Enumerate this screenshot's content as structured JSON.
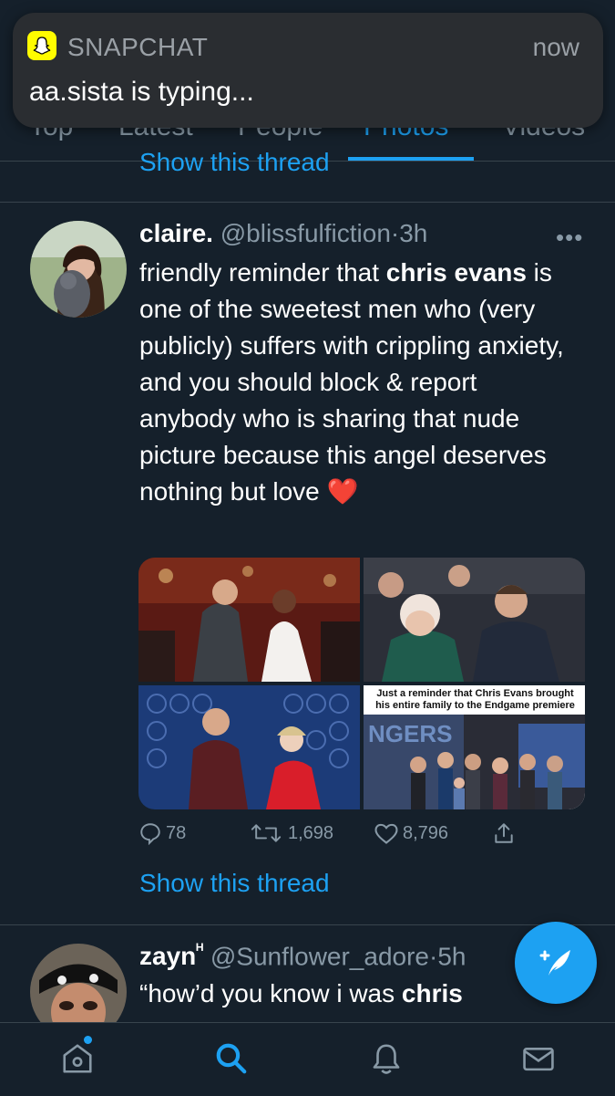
{
  "notification": {
    "app": "SNAPCHAT",
    "time": "now",
    "message": "aa.sista is typing..."
  },
  "tabs": [
    {
      "label": "Top"
    },
    {
      "label": "Latest"
    },
    {
      "label": "People"
    },
    {
      "label": "Photos"
    },
    {
      "label": "Videos"
    }
  ],
  "active_tab": "Photos",
  "top_show_thread": "Show this thread",
  "tweet": {
    "name": "claire.",
    "handle": "@blissfulfiction",
    "separator": "·",
    "time": "3h",
    "text_1": "friendly reminder that ",
    "text_bold": "chris evans",
    "text_2": " is one of the sweetest men who (very publicly) suffers with crippling anxiety, and you should block & report anybody who is sharing that nude picture because this angel deserves nothing but love ",
    "emoji": "❤️",
    "image_caption_1": "Just a reminder that Chris Evans brought",
    "image_caption_2": "his entire family to the Endgame premiere",
    "replies": "78",
    "retweets": "1,698",
    "likes": "8,796",
    "show_thread": "Show this thread"
  },
  "tweet2": {
    "name": "zayn",
    "name_sup": "ᴴ",
    "handle": "@Sunflower_adore",
    "separator": "·",
    "time": "5h",
    "text_1": "“how’d you know i was ",
    "text_bold": "chris"
  },
  "icons": {
    "notification_app": "snapchat-ghost-icon",
    "more": "more-horizontal-icon",
    "reply": "reply-icon",
    "retweet": "retweet-icon",
    "like": "heart-icon",
    "share": "share-icon",
    "compose": "compose-tweet-icon",
    "nav": [
      "home-icon",
      "search-icon",
      "bell-icon",
      "mail-icon"
    ]
  },
  "colors": {
    "background": "#15202b",
    "accent": "#1da1f2",
    "muted": "#8899a6",
    "divider": "#38444d",
    "snapchat_yellow": "#fffc00"
  }
}
